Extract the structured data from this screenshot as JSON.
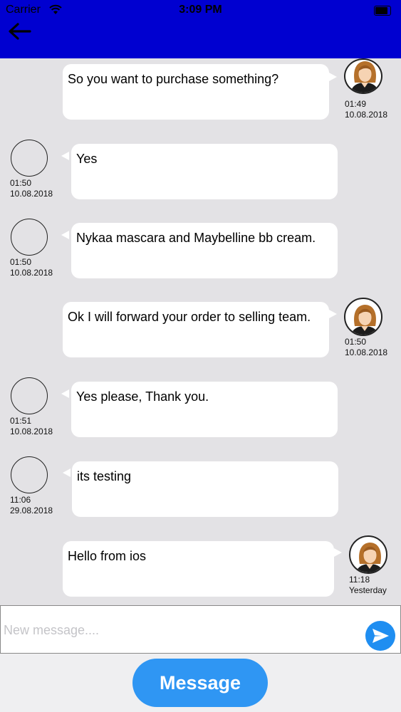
{
  "status_bar": {
    "carrier": "Carrier",
    "time": "3:09 PM"
  },
  "messages": [
    {
      "side": "right",
      "text": "So you want to purchase something?",
      "time": "01:49",
      "date": "10.08.2018"
    },
    {
      "side": "left",
      "text": "Yes",
      "time": "01:50",
      "date": "10.08.2018"
    },
    {
      "side": "left",
      "text": "Nykaa mascara and Maybelline bb cream.",
      "time": "01:50",
      "date": "10.08.2018"
    },
    {
      "side": "right",
      "text": "Ok I will forward your order to selling team.",
      "time": "01:50",
      "date": "10.08.2018"
    },
    {
      "side": "left",
      "text": "Yes please, Thank you.",
      "time": "01:51",
      "date": "10.08.2018"
    },
    {
      "side": "left",
      "text": "its testing",
      "time": "11:06",
      "date": "29.08.2018"
    },
    {
      "side": "right",
      "text": "Hello from ios",
      "time": "11:18",
      "date": "Yesterday"
    }
  ],
  "composer": {
    "placeholder": "New message....",
    "value": ""
  },
  "message_button_label": "Message",
  "colors": {
    "header": "#0000d0",
    "accent": "#2f96f3",
    "background": "#e3e2e5"
  },
  "icons": {
    "back": "arrow-left-icon",
    "send": "send-icon",
    "wifi": "wifi-icon",
    "battery": "battery-icon"
  }
}
